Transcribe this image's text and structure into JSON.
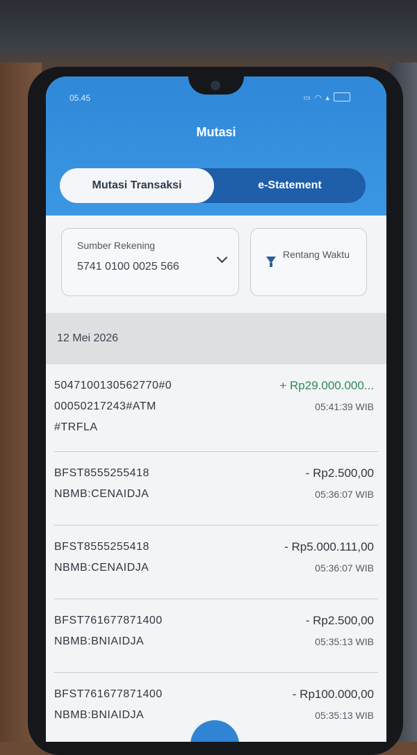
{
  "status_bar": {
    "time": "05.45",
    "icons": [
      "sim-icon",
      "wifi-icon",
      "signal-icon",
      "battery-icon"
    ]
  },
  "header": {
    "title": "Mutasi"
  },
  "tabs": [
    {
      "label": "Mutasi Transaksi",
      "active": true
    },
    {
      "label": "e-Statement",
      "active": false
    }
  ],
  "filters": {
    "account": {
      "label": "Sumber Rekening",
      "value": "5741 0100 0025 566"
    },
    "range": {
      "label": "Rentang Waktu"
    }
  },
  "date_header": "12 Mei 2026",
  "transactions": [
    {
      "description": "504710013056277​0#0 00050217243#ATM #TRFLA",
      "amount": "+ Rp29.000.000...",
      "time": "05:41:39 WIB",
      "type": "credit"
    },
    {
      "description": "BFST8555255418 NBMB:CENAIDJA",
      "amount": "- Rp2.500,00",
      "time": "05:36:07 WIB",
      "type": "debit"
    },
    {
      "description": "BFST8555255418 NBMB:CENAIDJA",
      "amount": "- Rp5.000.111,00",
      "time": "05:36:07 WIB",
      "type": "debit"
    },
    {
      "description": "BFST761677871400 NBMB:BNIAIDJA",
      "amount": "- Rp2.500,00",
      "time": "05:35:13 WIB",
      "type": "debit"
    },
    {
      "description": "BFST761677871400 NBMB:BNIAIDJA",
      "amount": "- Rp100.000,00",
      "time": "05:35:13 WIB",
      "type": "debit"
    }
  ],
  "colors": {
    "header_blue": "#3b97e3",
    "credit_green": "#2d8a56",
    "tab_dark": "#1f5ea8"
  }
}
